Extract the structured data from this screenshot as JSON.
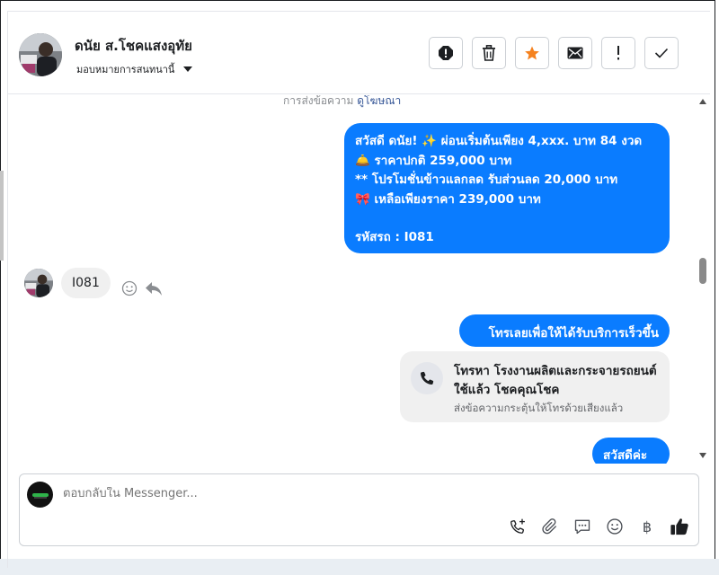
{
  "header": {
    "contact_name": "ดนัย ส.โชคแสงอุทัย",
    "assign_label": "มอบหมายการสนทนานี้",
    "action_icons": [
      "report-icon",
      "trash-icon",
      "star-icon",
      "envelope-icon",
      "exclamation-icon",
      "check-icon"
    ]
  },
  "thread": {
    "sent_note_prefix": "การส่งข้อความ",
    "sent_note_link": "ดูโฆษณา",
    "message1": {
      "line1": "สวัสดี ดนัย! ✨  ผ่อนเริ่มต้นเพียง 4,xxx. บาท 84 งวด",
      "line2": "🛎️ ราคาปกติ 259,000 บาท",
      "line3": "** โปรโมชั่นข้าวแลกลด รับส่วนลด 20,000 บาท",
      "line4": "🎀  เหลือเพียงราคา 239,000 บาท",
      "line5": "",
      "line6": "รหัสรถ : I081"
    },
    "incoming_text": "I081",
    "message2": "โทรเลยเพื่อให้ได้รับบริการเร็วขึ้น",
    "call_card": {
      "title": "โทรหา โรงงานผลิตและกระจายรถยนต์ใช้แล้ว โชคคุณโชค",
      "subtitle": "ส่งข้อความกระตุ้นให้โทรด้วยเสียงแล้ว"
    },
    "message3": "สวัสดีค่ะ"
  },
  "composer": {
    "placeholder": "ตอบกลับใน Messenger...",
    "tools": [
      "call-add-icon",
      "attachment-icon",
      "saved-reply-icon",
      "emoji-icon",
      "baht-icon",
      "like-icon"
    ],
    "baht_symbol": "฿"
  },
  "colors": {
    "accent": "#0a7cff",
    "incoming_bubble": "#f0f0f0",
    "star": "#f5821f"
  }
}
